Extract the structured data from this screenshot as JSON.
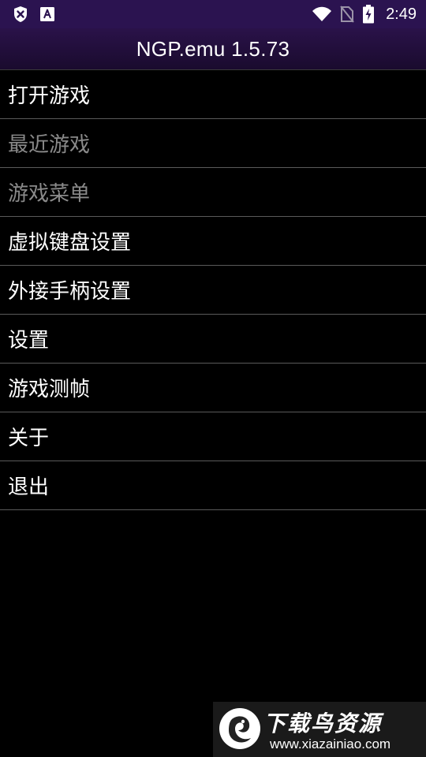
{
  "status_bar": {
    "time": "2:49",
    "icons": [
      "shield-x-icon",
      "font-a-icon",
      "wifi-icon",
      "no-sim-icon",
      "battery-charging-icon"
    ]
  },
  "title_bar": {
    "title": "NGP.emu 1.5.73"
  },
  "menu": {
    "items": [
      {
        "label": "打开游戏",
        "enabled": true
      },
      {
        "label": "最近游戏",
        "enabled": false
      },
      {
        "label": "游戏菜单",
        "enabled": false
      },
      {
        "label": "虚拟键盘设置",
        "enabled": true
      },
      {
        "label": "外接手柄设置",
        "enabled": true
      },
      {
        "label": "设置",
        "enabled": true
      },
      {
        "label": "游戏测帧",
        "enabled": true
      },
      {
        "label": "关于",
        "enabled": true
      },
      {
        "label": "退出",
        "enabled": true
      }
    ]
  },
  "watermark": {
    "title": "下载鸟资源",
    "url": "www.xiazainiao.com"
  },
  "colors": {
    "status_bar_bg": "#2b1350",
    "title_bar_bg": "#1a0b2e",
    "background": "#000000",
    "enabled_text": "#ffffff",
    "disabled_text": "#8a8a8a",
    "divider": "#5a5a5a"
  }
}
